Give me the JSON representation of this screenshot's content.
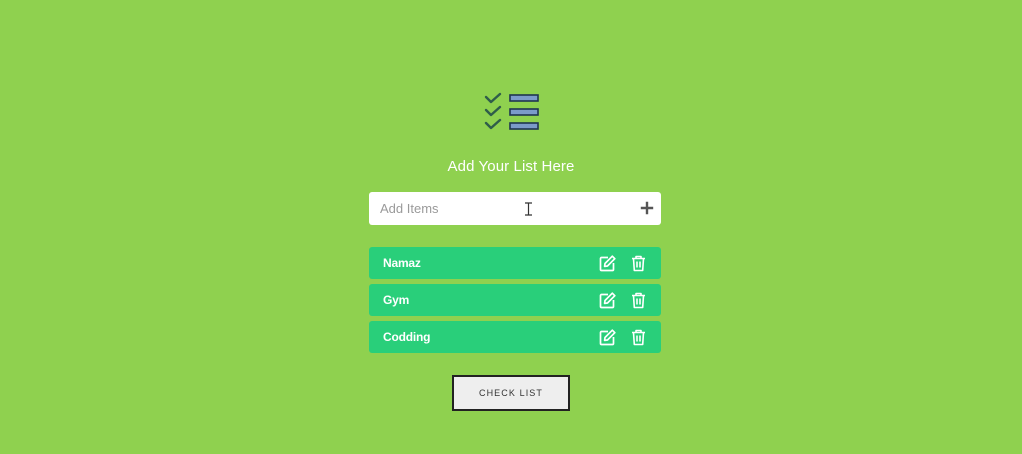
{
  "header": {
    "logo_icon": "checklist-icon",
    "title": "Add Your List Here"
  },
  "input": {
    "placeholder": "Add Items",
    "value": "",
    "add_icon": "plus-icon"
  },
  "items": [
    {
      "label": "Namaz",
      "edit_icon": "edit-icon",
      "delete_icon": "trash-icon"
    },
    {
      "label": "Gym",
      "edit_icon": "edit-icon",
      "delete_icon": "trash-icon"
    },
    {
      "label": "Codding",
      "edit_icon": "edit-icon",
      "delete_icon": "trash-icon"
    }
  ],
  "footer": {
    "check_list_label": "CHECK LIST"
  },
  "colors": {
    "background": "#8fd14f",
    "item_background": "#29cf7a",
    "input_background": "#ffffff",
    "button_background": "#eeeeee",
    "logo_bar": "#7b9bc9",
    "logo_check": "#2f5d4a"
  }
}
